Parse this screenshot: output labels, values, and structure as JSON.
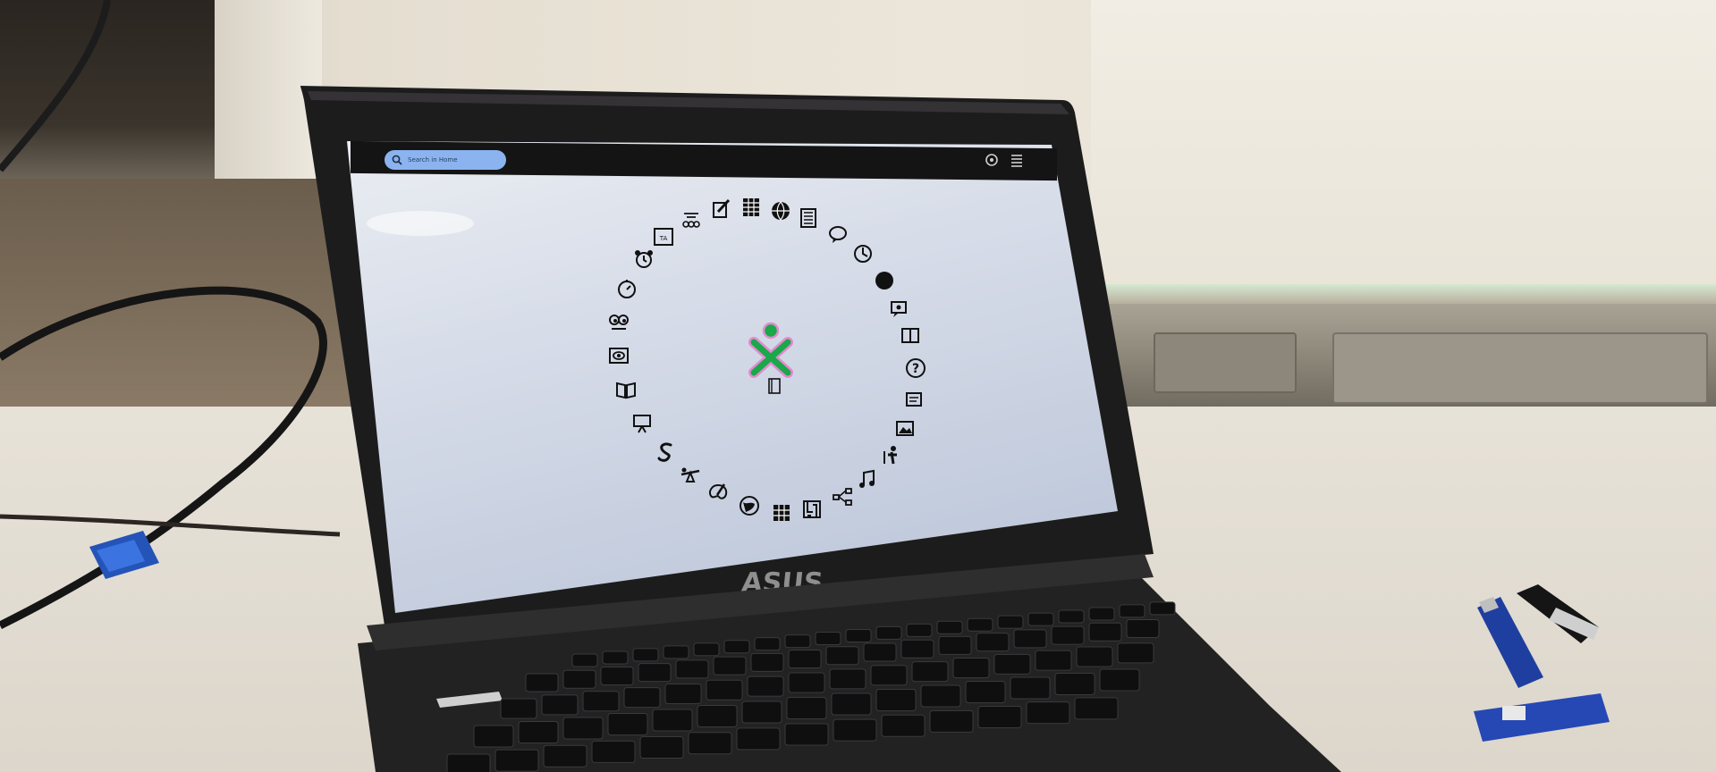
{
  "scene": {
    "laptop_brand": "ASUS"
  },
  "sugar_desktop": {
    "search_placeholder": "Search in Home",
    "center_icon": "xo-person-icon",
    "ring_icons": [
      "chat-icon",
      "clock-icon",
      "moon-icon",
      "speak-icon",
      "book-reader-icon",
      "help-icon",
      "write-icon",
      "image-viewer-icon",
      "turtle-art-icon",
      "music-icon",
      "tree-icon",
      "maze-icon",
      "sudoku-icon",
      "world-icon",
      "paint-icon",
      "seesaw-icon",
      "snake-icon",
      "presentation-icon",
      "open-book-icon",
      "eye-icon",
      "eyes-icon",
      "stopwatch-icon",
      "alarm-icon",
      "tamtam-icon",
      "abacus-icon",
      "pencil-icon",
      "calculator-icon",
      "browse-icon",
      "terminal-icon"
    ],
    "frame_icons": [
      "power-icon",
      "list-view-icon"
    ]
  },
  "colors": {
    "xo_stroke": "#1aa84a",
    "xo_fill": "#e48ad0",
    "search_bg": "#8bb3f0",
    "screen_top": "#e2e6ee",
    "screen_bottom": "#c3ccdc"
  }
}
